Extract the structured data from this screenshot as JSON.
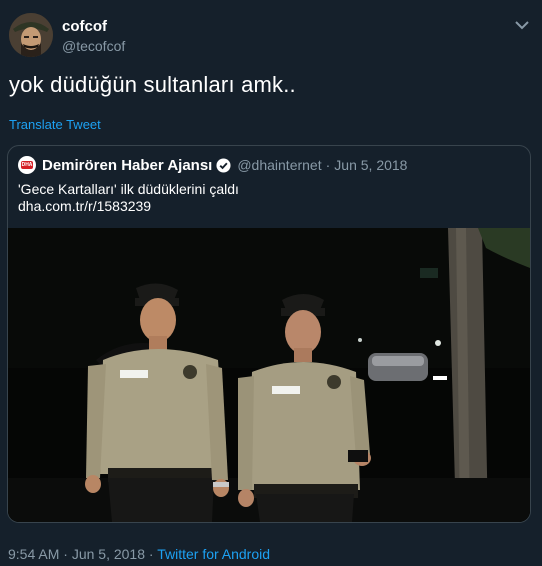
{
  "author": {
    "display_name": "cofcof",
    "handle": "@tecofcof"
  },
  "tweet": {
    "text": "yok düdüğün sultanları amk..",
    "translate_label": "Translate Tweet"
  },
  "quoted_tweet": {
    "account_name": "Demirören Haber Ajansı",
    "handle": "@dhainternet",
    "separator": "·",
    "date": "Jun 5, 2018",
    "logo_text": "DHA",
    "text": "'Gece Kartalları' ilk düdüklerini çaldı",
    "link": "dha.com.tr/r/1583239"
  },
  "footer": {
    "time": "9:54 AM",
    "sep1": " · ",
    "date": "Jun 5, 2018",
    "sep2": " · ",
    "source": "Twitter for Android"
  },
  "colors": {
    "background": "#15202b",
    "accent": "#1da1f2",
    "muted": "#8899a6",
    "border": "#38444d",
    "logo_red": "#d51f26"
  },
  "icons": {
    "menu": "chevron-down-icon",
    "verified": "verified-badge-icon"
  }
}
